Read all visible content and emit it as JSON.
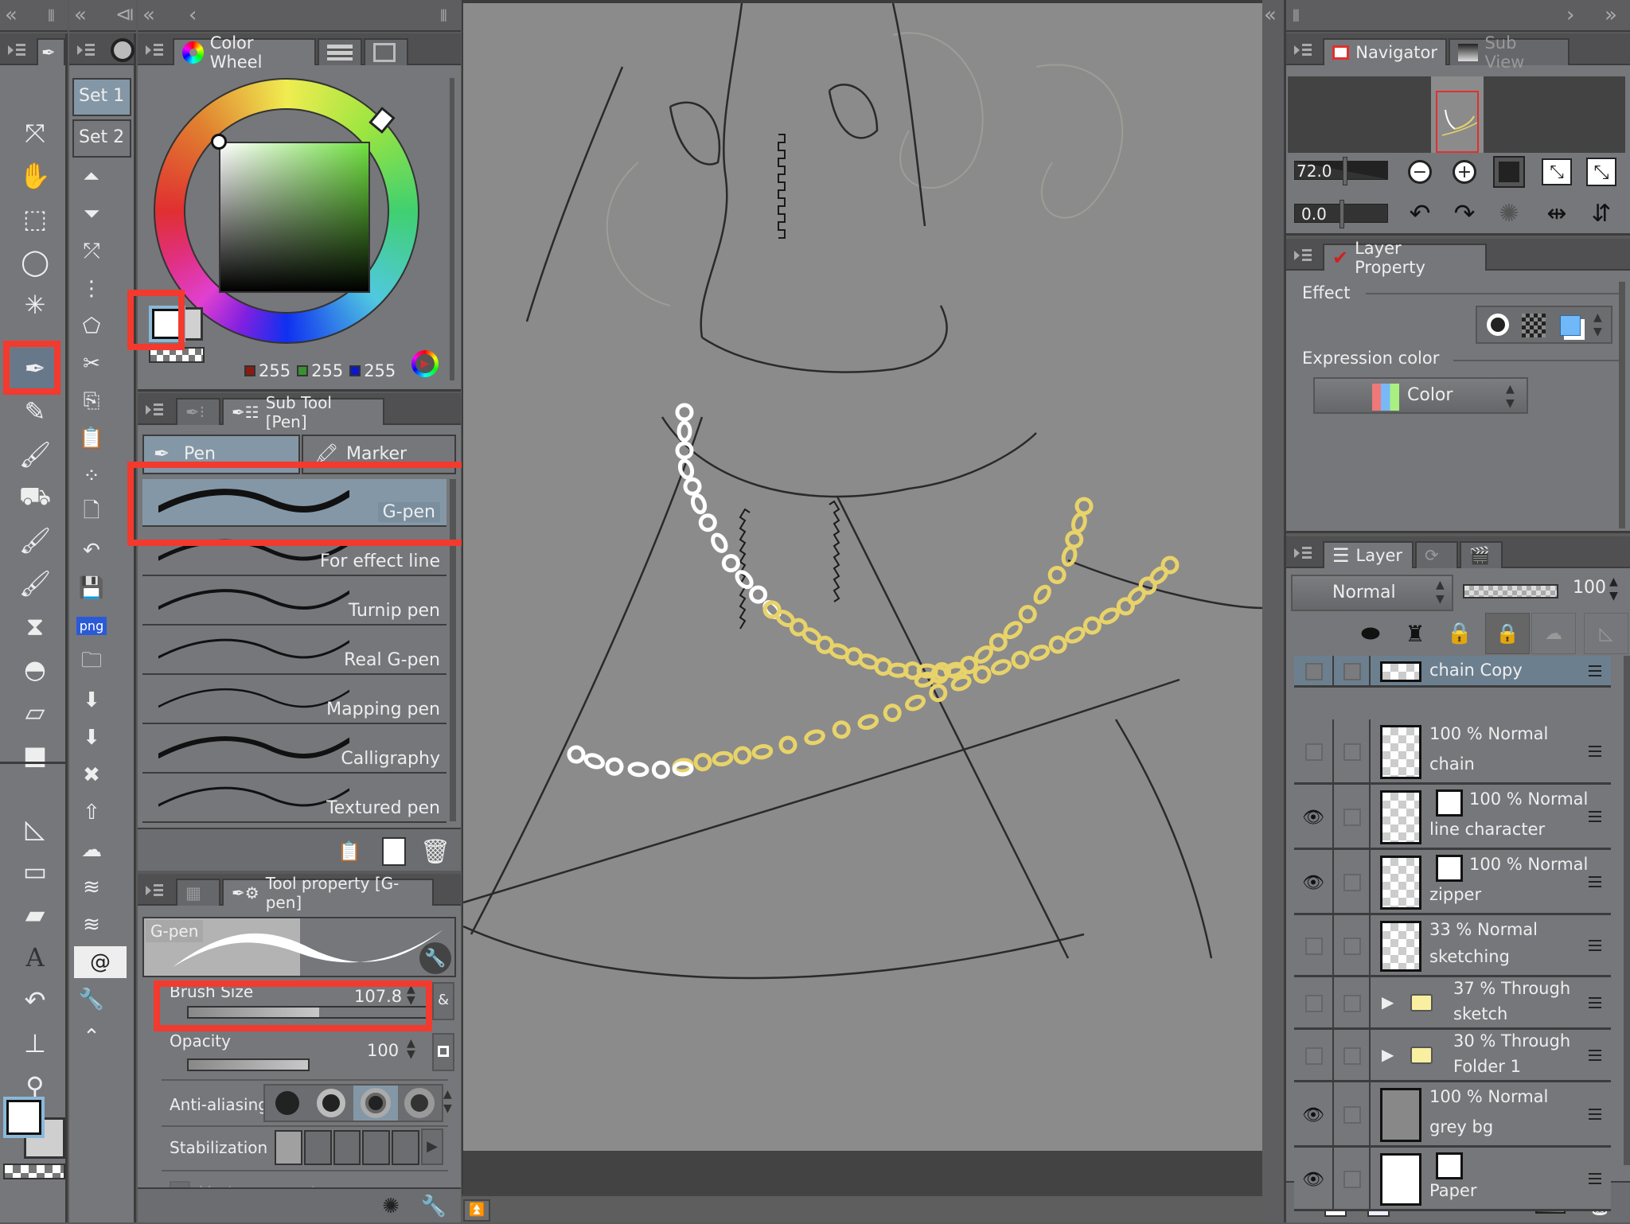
{
  "toolbar": {
    "tools": [
      {
        "name": "operation-tool",
        "glyph": "⤧"
      },
      {
        "name": "move-tool",
        "glyph": "✋"
      },
      {
        "name": "object-tool",
        "glyph": "⬚"
      },
      {
        "name": "selection-tool",
        "glyph": "◯"
      },
      {
        "name": "auto-select-tool",
        "glyph": "✳"
      },
      {
        "name": "pen-tool",
        "glyph": "✒",
        "active": true
      },
      {
        "name": "pencil-tool",
        "glyph": "✎"
      },
      {
        "name": "brush-tool",
        "glyph": "🖌"
      },
      {
        "name": "fill-tool",
        "glyph": "⛟"
      },
      {
        "name": "blend-tool",
        "glyph": "🖌"
      },
      {
        "name": "airbrush-tool",
        "glyph": "🖌"
      },
      {
        "name": "decoration-tool",
        "glyph": "⧗"
      },
      {
        "name": "hat-tool",
        "glyph": "◓"
      },
      {
        "name": "eraser-tool",
        "glyph": "▱"
      },
      {
        "name": "gradient-tool",
        "glyph": "■"
      },
      {
        "name": "ruler-tool",
        "glyph": "◺"
      },
      {
        "name": "frame-tool",
        "glyph": "▭"
      },
      {
        "name": "cut-frame-tool",
        "glyph": "▰"
      },
      {
        "name": "text-tool",
        "glyph": "A"
      },
      {
        "name": "balloon-tool",
        "glyph": "↶"
      },
      {
        "name": "correct-line-tool",
        "glyph": "⊥"
      },
      {
        "name": "eyedropper-tool",
        "glyph": "⚲"
      }
    ],
    "main_color": "#ffffff",
    "sub_color": "#cfcfcf"
  },
  "command_bar": {
    "sets": [
      "Set 1",
      "Set 2"
    ],
    "active_set": 0,
    "commands": [
      {
        "name": "scroll-up",
        "glyph": "⏶"
      },
      {
        "name": "scroll-down",
        "glyph": "⏷"
      },
      {
        "name": "transform",
        "glyph": "⤱"
      },
      {
        "name": "mesh-transform",
        "glyph": "⋮"
      },
      {
        "name": "free-transform",
        "glyph": "⬠"
      },
      {
        "name": "cut",
        "glyph": "✂"
      },
      {
        "name": "copy",
        "glyph": "⎘"
      },
      {
        "name": "paste",
        "glyph": "📋"
      },
      {
        "name": "dots",
        "glyph": "⁘"
      },
      {
        "name": "new-file",
        "glyph": "🗋"
      },
      {
        "name": "revert",
        "glyph": "↶"
      },
      {
        "name": "save",
        "glyph": "💾"
      },
      {
        "name": "export-png",
        "glyph": "png"
      },
      {
        "name": "open",
        "glyph": "🗀"
      },
      {
        "name": "import",
        "glyph": "⬇"
      },
      {
        "name": "import-image",
        "glyph": "⬇"
      },
      {
        "name": "clear",
        "glyph": "✖"
      },
      {
        "name": "layer-up",
        "glyph": "⇧"
      },
      {
        "name": "selection-layer",
        "glyph": "☁"
      },
      {
        "name": "merge-layers",
        "glyph": "≋"
      },
      {
        "name": "merge-visible",
        "glyph": "≋"
      },
      {
        "name": "clip",
        "glyph": "@"
      },
      {
        "name": "wrench",
        "glyph": "🔧"
      },
      {
        "name": "fit-screen",
        "glyph": "⌃"
      }
    ]
  },
  "color_wheel": {
    "tab_label": "Color Wheel",
    "rgb": {
      "r": "255",
      "g": "255",
      "b": "255"
    },
    "main_color": "#ffffff",
    "sub_color": "#d0d0d0",
    "hue_color": "#6fe040"
  },
  "sub_tool": {
    "tab_label": "Sub Tool [Pen]",
    "groups": [
      {
        "label": "Pen",
        "active": true
      },
      {
        "label": "Marker",
        "active": false
      }
    ],
    "brushes": [
      {
        "label": "G-pen",
        "active": true
      },
      {
        "label": "For effect line"
      },
      {
        "label": "Turnip pen"
      },
      {
        "label": "Real G-pen"
      },
      {
        "label": "Mapping pen"
      },
      {
        "label": "Calligraphy"
      },
      {
        "label": "Textured pen"
      }
    ]
  },
  "tool_property": {
    "tab_label": "Tool property [G-pen]",
    "preview_label": "G-pen",
    "brush_size_label": "Brush Size",
    "brush_size": "107.8",
    "brush_size_fraction": 0.55,
    "opacity_label": "Opacity",
    "opacity": "100",
    "opacity_fraction": 1.0,
    "anti_aliasing_label": "Anti-aliasing",
    "anti_aliasing_selected": 2,
    "stabilization_label": "Stabilization",
    "stabilization_level": 1,
    "vector_magnet_label": "Vector magnet"
  },
  "navigator": {
    "tab_label": "Navigator",
    "sub_view_label": "Sub View",
    "zoom": "72.0",
    "rotation": "0.0"
  },
  "layer_property": {
    "tab_label": "Layer Property",
    "effect_label": "Effect",
    "expression_color_label": "Expression color",
    "expression_color_value": "Color"
  },
  "layers_panel": {
    "tab_label": "Layer",
    "blend_mode": "Normal",
    "opacity": "100",
    "layers": [
      {
        "line1": "",
        "line2": "chain Copy",
        "visible": false,
        "selected": true,
        "type": "raster"
      },
      {
        "line1": "100 % Normal",
        "line2": "chain",
        "visible": false,
        "type": "raster"
      },
      {
        "line1": "100 % Normal",
        "line2": "line character",
        "visible": true,
        "type": "vector"
      },
      {
        "line1": "100 % Normal",
        "line2": "zipper",
        "visible": true,
        "type": "vector"
      },
      {
        "line1": "33 % Normal",
        "line2": "sketching",
        "visible": false,
        "type": "raster"
      },
      {
        "line1": "37 % Through",
        "line2": "sketch",
        "visible": false,
        "type": "folder"
      },
      {
        "line1": "30 % Through",
        "line2": "Folder 1",
        "visible": false,
        "type": "folder"
      },
      {
        "line1": "100 % Normal",
        "line2": "grey bg",
        "visible": true,
        "type": "fill"
      },
      {
        "line1": "",
        "line2": "Paper",
        "visible": true,
        "type": "paper"
      }
    ]
  },
  "canvas": {
    "background": "#8b8b8b",
    "chain_gold": "#e8d36a",
    "chain_white": "#ffffff"
  },
  "highlight_color": "#f23a2f"
}
